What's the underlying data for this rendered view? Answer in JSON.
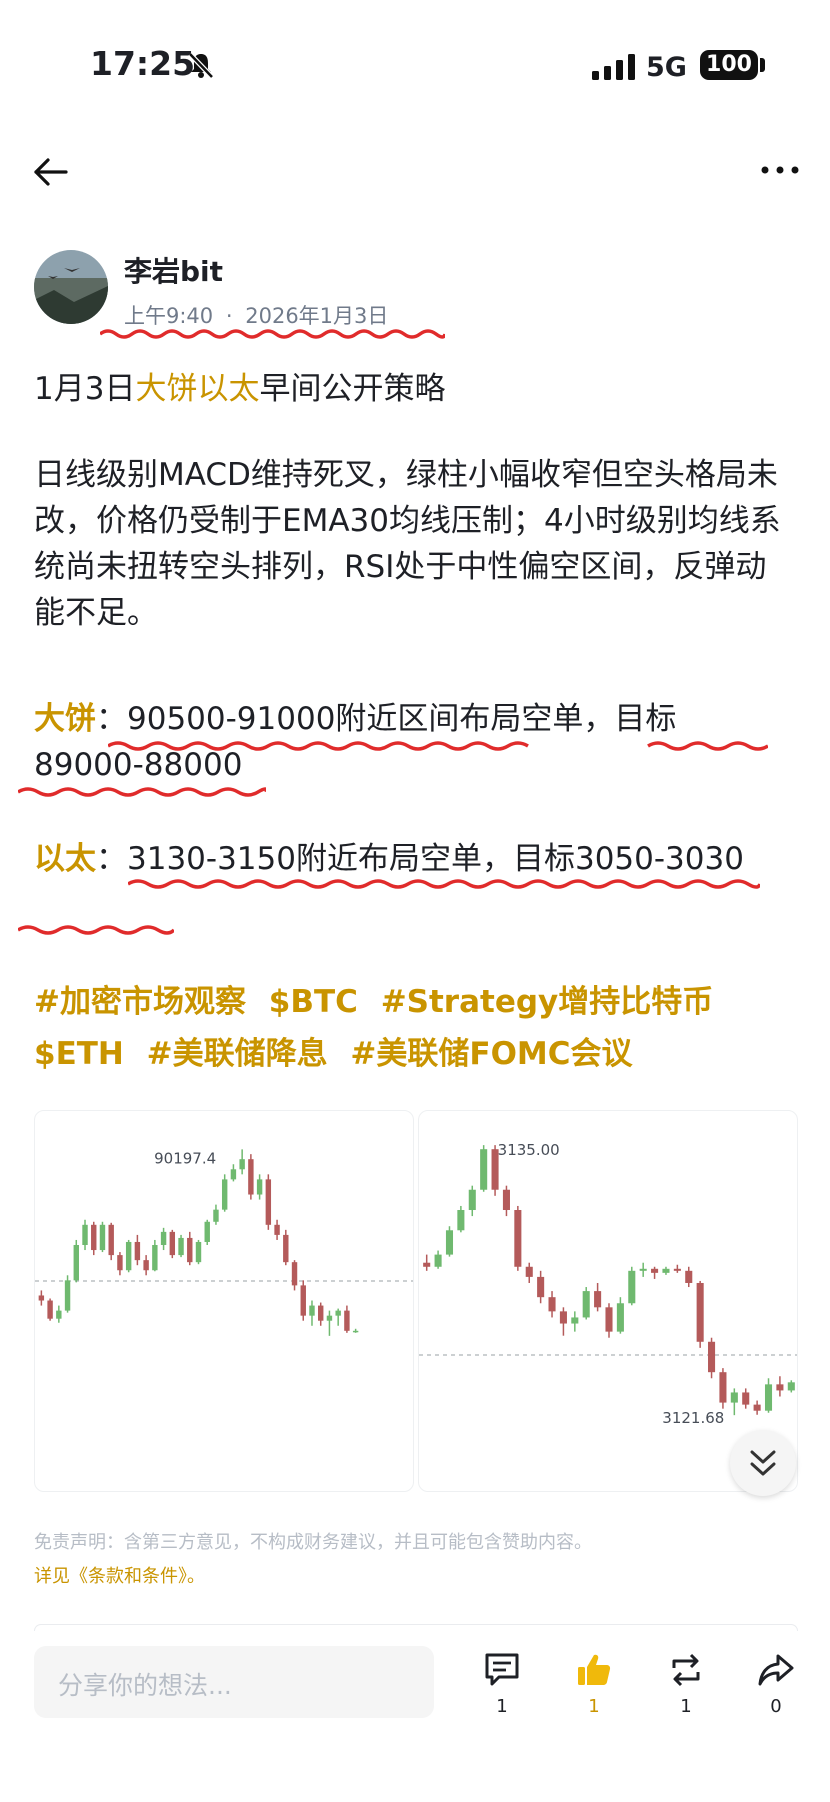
{
  "status_bar": {
    "time": "17:25",
    "network": "5G",
    "battery": "100"
  },
  "author": {
    "name": "李岩bit",
    "time": "上午9:40",
    "separator": "·",
    "date": "2026年1月3日"
  },
  "post": {
    "title_prefix": "1月3日",
    "title_highlight": "大饼以太",
    "title_suffix": "早间公开策略",
    "analysis": "日线级别MACD维持死叉，绿柱小幅收窄但空头格局未改，价格仍受制于EMA30均线压制；4小时级别均线系统尚未扭转空头排列，RSI处于中性偏空区间，反弹动能不足。",
    "btc_label": "大饼",
    "colon": "：",
    "btc_text": "90500-91000附近区间布局空单，目标89000-88000",
    "eth_label": "以太",
    "eth_text": "3130-3150附近布局空单，目标3050-3030"
  },
  "tags": [
    "#加密市场观察",
    "$BTC",
    "#Strategy增持比特币",
    "$ETH",
    "#美联储降息",
    "#美联储FOMC会议"
  ],
  "chart_data": [
    {
      "type": "candlestick",
      "title": "",
      "labels": [
        "90197.4"
      ],
      "high_label": "90197.4",
      "y_range": [
        88200,
        90300
      ],
      "ohlc": [
        [
          88750,
          88800,
          88650,
          88700
        ],
        [
          88700,
          88720,
          88500,
          88520
        ],
        [
          88520,
          88650,
          88480,
          88600
        ],
        [
          88600,
          88950,
          88580,
          88900
        ],
        [
          88900,
          89300,
          88880,
          89250
        ],
        [
          89250,
          89500,
          89200,
          89450
        ],
        [
          89450,
          89480,
          89150,
          89200
        ],
        [
          89200,
          89480,
          89180,
          89450
        ],
        [
          89450,
          89470,
          89100,
          89150
        ],
        [
          89150,
          89180,
          88950,
          89000
        ],
        [
          89000,
          89300,
          88980,
          89280
        ],
        [
          89280,
          89350,
          89050,
          89100
        ],
        [
          89100,
          89150,
          88950,
          89000
        ],
        [
          89000,
          89300,
          88990,
          89250
        ],
        [
          89250,
          89420,
          89200,
          89380
        ],
        [
          89380,
          89400,
          89120,
          89150
        ],
        [
          89150,
          89350,
          89130,
          89320
        ],
        [
          89320,
          89380,
          89050,
          89080
        ],
        [
          89080,
          89300,
          89060,
          89280
        ],
        [
          89280,
          89500,
          89250,
          89480
        ],
        [
          89480,
          89650,
          89450,
          89600
        ],
        [
          89600,
          89950,
          89580,
          89900
        ],
        [
          89900,
          90050,
          89880,
          90000
        ],
        [
          90000,
          90197.4,
          89950,
          90100
        ],
        [
          90100,
          90150,
          89700,
          89750
        ],
        [
          89750,
          89950,
          89700,
          89900
        ],
        [
          89900,
          89950,
          89400,
          89450
        ],
        [
          89450,
          89500,
          89300,
          89350
        ],
        [
          89350,
          89400,
          89050,
          89080
        ],
        [
          89080,
          89100,
          88800,
          88850
        ],
        [
          88850,
          88900,
          88500,
          88550
        ],
        [
          88550,
          88700,
          88450,
          88650
        ],
        [
          88650,
          88680,
          88450,
          88500
        ],
        [
          88500,
          88600,
          88350,
          88550
        ],
        [
          88550,
          88620,
          88450,
          88600
        ],
        [
          88600,
          88650,
          88380,
          88400
        ],
        [
          88400,
          88420,
          88380,
          88400
        ]
      ]
    },
    {
      "type": "candlestick",
      "title": "",
      "labels": [
        "3135.00",
        "3121.68"
      ],
      "high_label": "3135.00",
      "low_label": "3121.68",
      "y_range": [
        3120.8,
        3135.5
      ],
      "ohlc": [
        [
          3129.2,
          3129.6,
          3128.8,
          3129.0
        ],
        [
          3129.0,
          3129.8,
          3128.9,
          3129.6
        ],
        [
          3129.6,
          3131.0,
          3129.5,
          3130.8
        ],
        [
          3130.8,
          3132.0,
          3130.7,
          3131.8
        ],
        [
          3131.8,
          3133.0,
          3131.5,
          3132.8
        ],
        [
          3132.8,
          3135.0,
          3132.7,
          3134.8
        ],
        [
          3134.8,
          3135.0,
          3132.5,
          3132.8
        ],
        [
          3132.8,
          3133.0,
          3131.5,
          3131.8
        ],
        [
          3131.8,
          3132.0,
          3128.8,
          3129.0
        ],
        [
          3129.0,
          3129.2,
          3128.2,
          3128.5
        ],
        [
          3128.5,
          3128.8,
          3127.2,
          3127.5
        ],
        [
          3127.5,
          3127.8,
          3126.5,
          3126.8
        ],
        [
          3126.8,
          3127.0,
          3125.6,
          3126.2
        ],
        [
          3126.2,
          3126.8,
          3125.8,
          3126.5
        ],
        [
          3126.5,
          3128.0,
          3126.4,
          3127.8
        ],
        [
          3127.8,
          3128.2,
          3126.8,
          3127.0
        ],
        [
          3127.0,
          3127.2,
          3125.5,
          3125.8
        ],
        [
          3125.8,
          3127.5,
          3125.7,
          3127.2
        ],
        [
          3127.2,
          3129.0,
          3127.1,
          3128.8
        ],
        [
          3128.8,
          3129.2,
          3128.5,
          3128.9
        ],
        [
          3128.9,
          3129.0,
          3128.4,
          3128.7
        ],
        [
          3128.7,
          3129.0,
          3128.6,
          3128.9
        ],
        [
          3128.9,
          3129.1,
          3128.7,
          3128.8
        ],
        [
          3128.8,
          3129.0,
          3128.0,
          3128.2
        ],
        [
          3128.2,
          3128.3,
          3125.0,
          3125.3
        ],
        [
          3125.3,
          3125.5,
          3123.5,
          3123.8
        ],
        [
          3123.8,
          3124.0,
          3122.0,
          3122.3
        ],
        [
          3122.3,
          3123.0,
          3121.68,
          3122.8
        ],
        [
          3122.8,
          3123.0,
          3122.0,
          3122.2
        ],
        [
          3122.2,
          3122.4,
          3121.7,
          3121.9
        ],
        [
          3121.9,
          3123.5,
          3121.8,
          3123.2
        ],
        [
          3123.2,
          3123.6,
          3122.6,
          3122.9
        ],
        [
          3122.9,
          3123.4,
          3122.8,
          3123.3
        ]
      ]
    }
  ],
  "disclaimer": "免责声明：含第三方意见，不构成财务建议，并且可能包含赞助内容。",
  "terms_link": "详见《条款和条件》。",
  "comment_placeholder": "分享你的想法...",
  "actions": {
    "comments": "1",
    "likes": "1",
    "reposts": "1",
    "shares": "0"
  },
  "colors": {
    "accent": "#c99400",
    "up": "#6fb96f",
    "down": "#b45a5a",
    "underline": "#e02b2b"
  }
}
